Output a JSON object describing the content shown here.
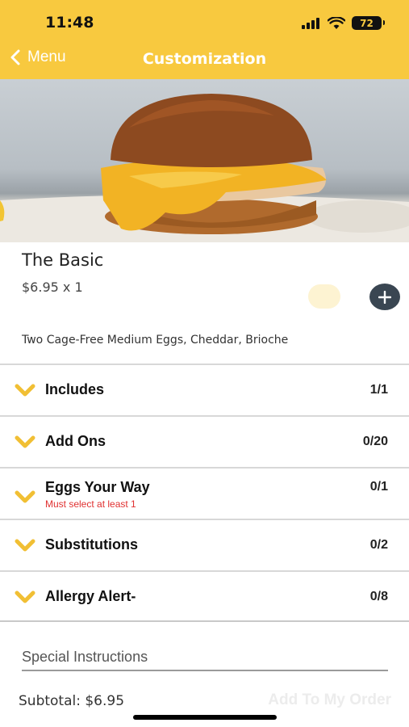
{
  "status_bar": {
    "time": "11:48",
    "battery": "72"
  },
  "nav": {
    "back_label": "Menu",
    "title": "Customization"
  },
  "item": {
    "name": "The Basic",
    "price_qty": "$6.95 x 1",
    "description": "Two Cage-Free Medium Eggs, Cheddar, Brioche"
  },
  "sections": [
    {
      "title": "Includes",
      "count": "1/1"
    },
    {
      "title": "Add Ons",
      "count": "0/20"
    },
    {
      "title": "Eggs Your Way",
      "count": "0/1",
      "requirement": "Must select at least 1"
    },
    {
      "title": "Substitutions",
      "count": "0/2"
    },
    {
      "title": "Allergy Alert-",
      "count": "0/8"
    }
  ],
  "special_instructions": {
    "placeholder": "Special Instructions"
  },
  "footer": {
    "subtotal": "Subtotal: $6.95",
    "add_button": "Add To My Order"
  },
  "colors": {
    "brand_yellow": "#f8c93f",
    "add_button_bg": "#3a4652",
    "required_red": "#e03030"
  }
}
